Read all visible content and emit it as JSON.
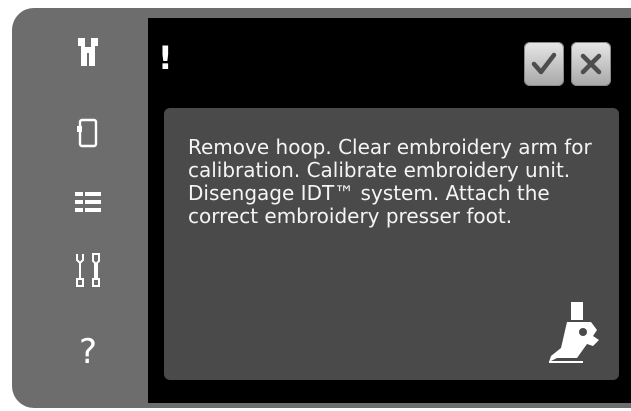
{
  "sidebar": {
    "items": [
      {
        "name": "machine-icon"
      },
      {
        "name": "hoop-icon"
      },
      {
        "name": "menu-list-icon"
      },
      {
        "name": "settings-tools-icon"
      },
      {
        "name": "help-icon",
        "glyph": "?"
      }
    ]
  },
  "dialog": {
    "alert_mark": "!",
    "message": "Remove hoop. Clear embroidery arm for calibration. Calibrate embroidery unit. Disengage IDT™ system. Attach the correct embroidery presser foot.",
    "ok_icon": "checkmark-icon",
    "close_icon": "close-icon",
    "illustration_icon": "presser-foot-icon"
  },
  "colors": {
    "bezel": "#6d6d6d",
    "screen": "#000000",
    "panel": "#4a4a4a",
    "text": "#f4f4f4"
  }
}
